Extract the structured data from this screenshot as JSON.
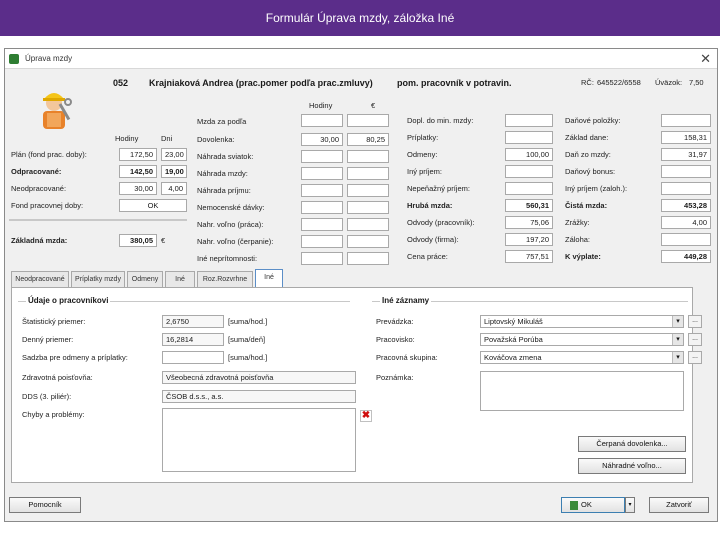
{
  "slide_title": "Formulár Úprava mzdy, záložka Iné",
  "window": {
    "title": "Úprava mzdy",
    "close_glyph": "✕"
  },
  "header": {
    "code": "052",
    "employee": "Krajniaková Andrea (prac.pomer podľa prac.zmluvy)",
    "position": "pom. pracovník v potravin.",
    "rc_label": "RČ:",
    "rc_value": "645522/6558",
    "uvazok_label": "Úväzok:",
    "uvazok_value": "7,50"
  },
  "left": {
    "col_hodiny": "Hodiny",
    "col_dni": "Dni",
    "rows": [
      {
        "label": "Plán (fond prac. doby):",
        "hodiny": "172,50",
        "dni": "23,00",
        "bold": false
      },
      {
        "label": "Odpracované:",
        "hodiny": "142,50",
        "dni": "19,00",
        "bold": true
      },
      {
        "label": "Neodpracované:",
        "hodiny": "30,00",
        "dni": "4,00",
        "bold": false
      }
    ],
    "fond_label": "Fond pracovnej doby:",
    "fond_value": "OK",
    "zakladna_label": "Základná mzda:",
    "zakladna_value": "380,05",
    "zakladna_unit": "€"
  },
  "middle": {
    "header_mzda": "Mzda za podľa",
    "header_hodiny": "Hodiny",
    "header_eur": "€",
    "rows": [
      {
        "label": "Dovolenka:",
        "hodiny": "30,00",
        "eur": "80,25"
      },
      {
        "label": "Náhrada sviatok:",
        "hodiny": "",
        "eur": ""
      },
      {
        "label": "Náhrada mzdy:",
        "hodiny": "",
        "eur": ""
      },
      {
        "label": "Náhrada príjmu:",
        "hodiny": "",
        "eur": ""
      },
      {
        "label": "Nemocenské dávky:",
        "hodiny": "",
        "eur": ""
      },
      {
        "label": "Nahr. voľno (práca):",
        "hodiny": "",
        "eur": ""
      },
      {
        "label": "Nahr. voľno (čerpanie):",
        "hodiny": "",
        "eur": ""
      },
      {
        "label": "Iné neprítomnosti:",
        "hodiny": "",
        "eur": ""
      }
    ]
  },
  "right1": {
    "rows": [
      {
        "label": "Dopl. do min. mzdy:",
        "value": "",
        "bold": false
      },
      {
        "label": "Príplatky:",
        "value": "",
        "bold": false
      },
      {
        "label": "Odmeny:",
        "value": "100,00",
        "bold": false
      },
      {
        "label": "Iný príjem:",
        "value": "",
        "bold": false
      },
      {
        "label": "Nepeňažný príjem:",
        "value": "",
        "bold": false
      },
      {
        "label": "Hrubá mzda:",
        "value": "560,31",
        "bold": true
      },
      {
        "label": "Odvody (pracovník):",
        "value": "75,06",
        "bold": false
      },
      {
        "label": "Odvody (firma):",
        "value": "197,20",
        "bold": false
      },
      {
        "label": "Cena práce:",
        "value": "757,51",
        "bold": false
      }
    ]
  },
  "right2": {
    "rows": [
      {
        "label": "Daňové položky:",
        "value": "",
        "bold": false
      },
      {
        "label": "Základ dane:",
        "value": "158,31",
        "bold": false
      },
      {
        "label": "Daň zo mzdy:",
        "value": "31,97",
        "bold": false
      },
      {
        "label": "Daňový bonus:",
        "value": "",
        "bold": false
      },
      {
        "label": "Iný príjem (zaloh.):",
        "value": "",
        "bold": false
      },
      {
        "label": "Čistá mzda:",
        "value": "453,28",
        "bold": true
      },
      {
        "label": "Zrážky:",
        "value": "4,00",
        "bold": false
      },
      {
        "label": "Záloha:",
        "value": "",
        "bold": false
      },
      {
        "label": "K výplate:",
        "value": "449,28",
        "bold": true
      }
    ]
  },
  "tabs": [
    {
      "label": "Neodpracované",
      "active": false
    },
    {
      "label": "Príplatky mzdy",
      "active": false
    },
    {
      "label": "Odmeny",
      "active": false
    },
    {
      "label": "Iné",
      "active": false
    },
    {
      "label": "Roz.Rozvrhne",
      "active": false
    },
    {
      "label": "Iné",
      "active": true
    }
  ],
  "udaje": {
    "title": "Údaje o pracovníkovi",
    "rows": [
      {
        "label": "Štatistický priemer:",
        "value": "2,6750",
        "unit": "[suma/hod.]"
      },
      {
        "label": "Denný priemer:",
        "value": "16,2814",
        "unit": "[suma/deň]"
      },
      {
        "label": "Sadzba pre odmeny a príplatky:",
        "value": "",
        "unit": "[suma/hod.]"
      },
      {
        "label": "Zdravotná poisťovňa:",
        "value": "Všeobecná zdravotná poisťovňa",
        "unit": ""
      },
      {
        "label": "DDS (3. piliér):",
        "value": "ČSOB d.s.s., a.s.",
        "unit": ""
      }
    ],
    "chyby_label": "Chyby a problémy:"
  },
  "ine": {
    "title": "Iné záznamy",
    "rows": [
      {
        "label": "Prevádzka:",
        "value": "Liptovský Mikuláš"
      },
      {
        "label": "Pracovisko:",
        "value": "Považská Porúba"
      },
      {
        "label": "Pracovná skupina:",
        "value": "Kováčova zmena"
      }
    ],
    "poznamka_label": "Poznámka:",
    "more_glyph": "...",
    "btn_cerpana": "Čerpaná dovolenka...",
    "btn_nahradne": "Náhradné voľno..."
  },
  "footer": {
    "pomocnik": "Pomocník",
    "ok": "OK",
    "zatvorit": "Zatvoriť"
  }
}
